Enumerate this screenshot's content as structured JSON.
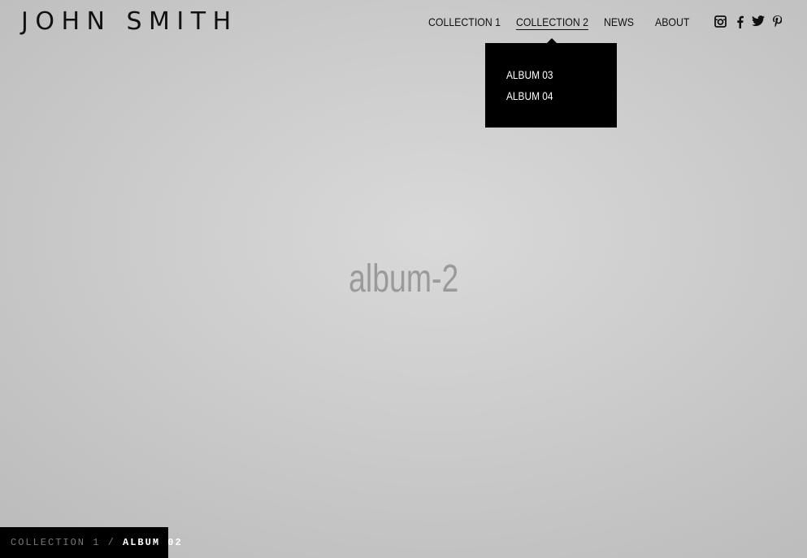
{
  "site": {
    "title": "JOHN SMITH"
  },
  "nav": {
    "items": [
      {
        "label": "COLLECTION 1"
      },
      {
        "label": "COLLECTION 2"
      },
      {
        "label": "NEWS"
      },
      {
        "label": "ABOUT"
      }
    ],
    "active_item": "COLLECTION 2"
  },
  "social": {
    "icons": [
      "instagram-icon",
      "facebook-icon",
      "twitter-icon",
      "pinterest-icon"
    ]
  },
  "dropdown": {
    "items": [
      {
        "label": "ALBUM 03"
      },
      {
        "label": "ALBUM 04"
      }
    ]
  },
  "main": {
    "placeholder": "album-2"
  },
  "breadcrumb": {
    "parent": "COLLECTION 1",
    "separator": "/",
    "current": "ALBUM 02"
  },
  "colors": {
    "background": "#d0d0d0",
    "text": "#111111",
    "dropdown_bg": "#000000",
    "placeholder": "#9a9a9a"
  }
}
